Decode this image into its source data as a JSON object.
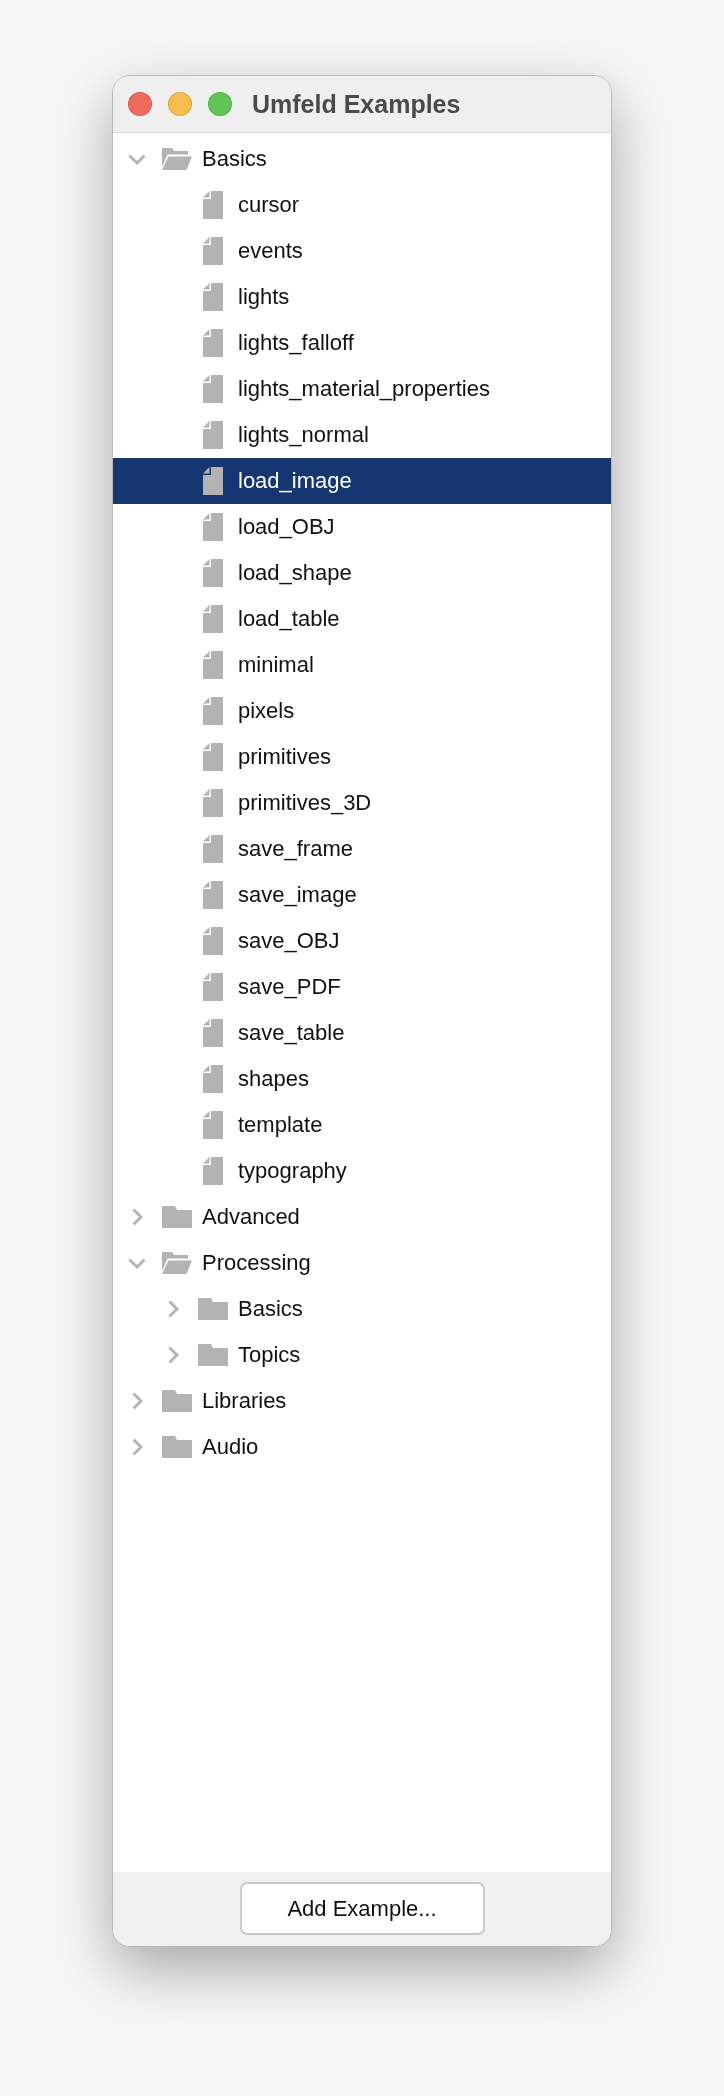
{
  "window": {
    "title": "Umfeld Examples"
  },
  "tree": [
    {
      "kind": "folder",
      "label": "Basics",
      "expanded": true,
      "selected": false,
      "children": [
        {
          "kind": "file",
          "label": "cursor",
          "selected": false
        },
        {
          "kind": "file",
          "label": "events",
          "selected": false
        },
        {
          "kind": "file",
          "label": "lights",
          "selected": false
        },
        {
          "kind": "file",
          "label": "lights_falloff",
          "selected": false
        },
        {
          "kind": "file",
          "label": "lights_material_properties",
          "selected": false
        },
        {
          "kind": "file",
          "label": "lights_normal",
          "selected": false
        },
        {
          "kind": "file",
          "label": "load_image",
          "selected": true
        },
        {
          "kind": "file",
          "label": "load_OBJ",
          "selected": false
        },
        {
          "kind": "file",
          "label": "load_shape",
          "selected": false
        },
        {
          "kind": "file",
          "label": "load_table",
          "selected": false
        },
        {
          "kind": "file",
          "label": "minimal",
          "selected": false
        },
        {
          "kind": "file",
          "label": "pixels",
          "selected": false
        },
        {
          "kind": "file",
          "label": "primitives",
          "selected": false
        },
        {
          "kind": "file",
          "label": "primitives_3D",
          "selected": false
        },
        {
          "kind": "file",
          "label": "save_frame",
          "selected": false
        },
        {
          "kind": "file",
          "label": "save_image",
          "selected": false
        },
        {
          "kind": "file",
          "label": "save_OBJ",
          "selected": false
        },
        {
          "kind": "file",
          "label": "save_PDF",
          "selected": false
        },
        {
          "kind": "file",
          "label": "save_table",
          "selected": false
        },
        {
          "kind": "file",
          "label": "shapes",
          "selected": false
        },
        {
          "kind": "file",
          "label": "template",
          "selected": false
        },
        {
          "kind": "file",
          "label": "typography",
          "selected": false
        }
      ]
    },
    {
      "kind": "folder",
      "label": "Advanced",
      "expanded": false,
      "selected": false
    },
    {
      "kind": "folder",
      "label": "Processing",
      "expanded": true,
      "selected": false,
      "children": [
        {
          "kind": "folder",
          "label": "Basics",
          "expanded": false,
          "selected": false
        },
        {
          "kind": "folder",
          "label": "Topics",
          "expanded": false,
          "selected": false
        }
      ]
    },
    {
      "kind": "folder",
      "label": "Libraries",
      "expanded": false,
      "selected": false
    },
    {
      "kind": "folder",
      "label": "Audio",
      "expanded": false,
      "selected": false
    }
  ],
  "footer": {
    "button": "Add Example..."
  }
}
